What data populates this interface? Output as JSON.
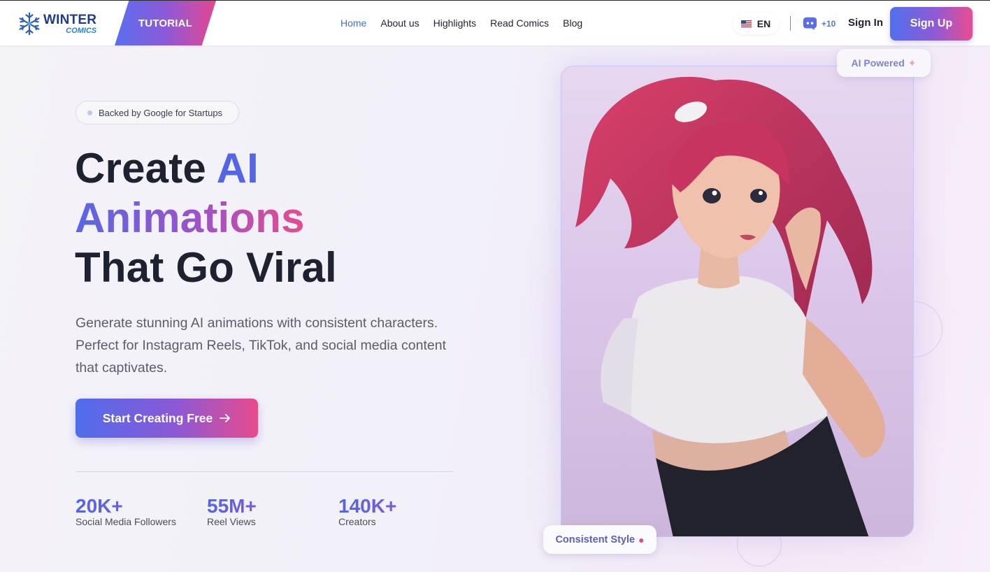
{
  "header": {
    "logo": {
      "line1": "WINTER",
      "line2": "COMICS"
    },
    "tutorial_label": "TUTORIAL",
    "nav": [
      {
        "label": "Home",
        "active": true
      },
      {
        "label": "About us",
        "active": false
      },
      {
        "label": "Highlights",
        "active": false
      },
      {
        "label": "Read Comics",
        "active": false
      },
      {
        "label": "Blog",
        "active": false
      }
    ],
    "language": "EN",
    "discord_count": "+10",
    "signin_label": "Sign In",
    "signup_label": "Sign Up"
  },
  "hero": {
    "badge": "Backed by Google for Startups",
    "headline": {
      "part1": "Create ",
      "highlight1": "AI",
      "highlight2": "Animations",
      "line3": "That Go Viral"
    },
    "description": "Generate stunning AI animations with consistent characters. Perfect for Instagram Reels, TikTok, and social media content that captivates.",
    "cta_label": "Start Creating Free",
    "stats": [
      {
        "value": "20K+",
        "label": "Social Media Followers"
      },
      {
        "value": "55M+",
        "label": "Reel Views"
      },
      {
        "value": "140K+",
        "label": "Creators"
      }
    ]
  },
  "showcase": {
    "chip_top": "AI Powered",
    "chip_bottom": "Consistent Style"
  },
  "colors": {
    "accent_blue": "#3d6ee0",
    "gradient_start": "#5170ec",
    "gradient_mid": "#8f5ad6",
    "gradient_end": "#ea4d8e",
    "stat_color": "#5a5fd8"
  }
}
